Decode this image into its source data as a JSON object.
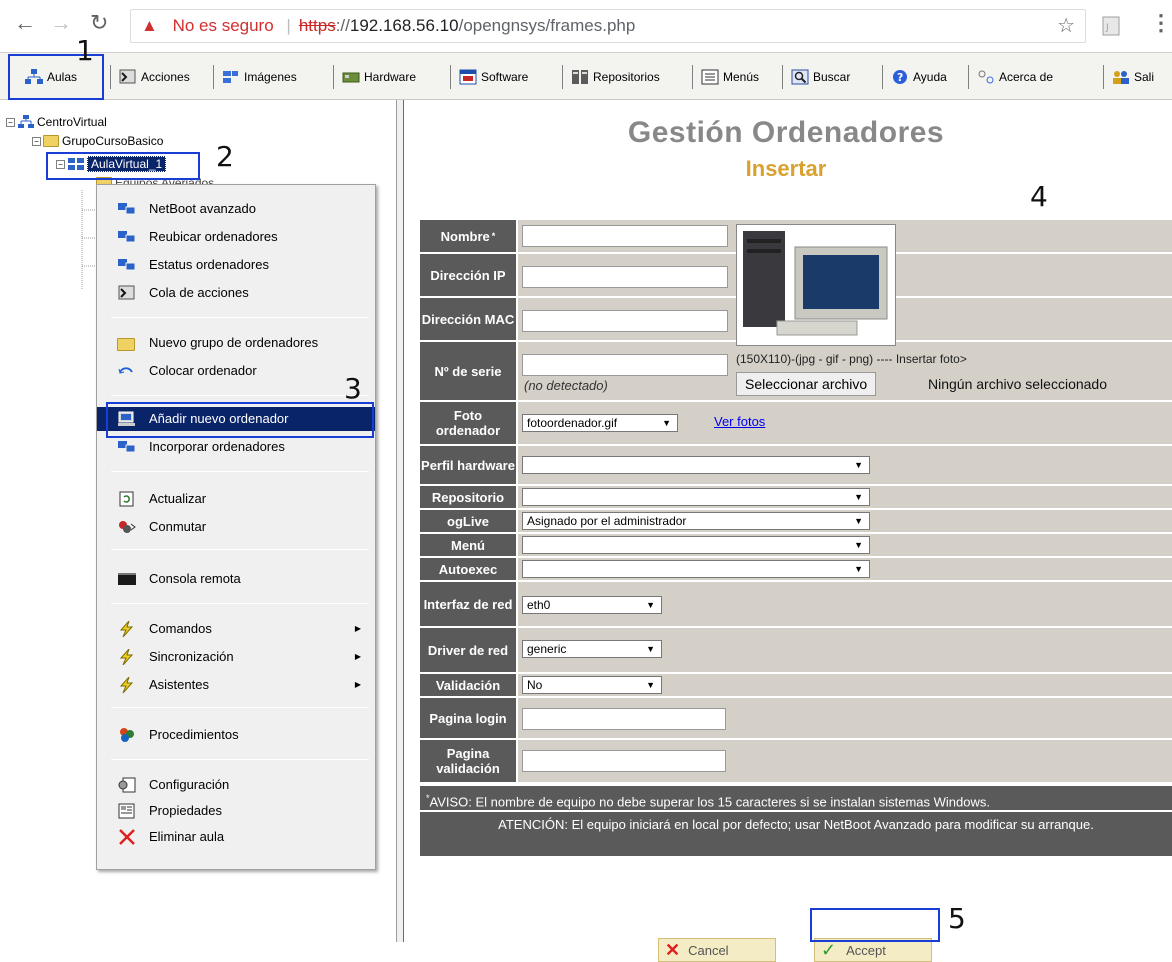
{
  "browser": {
    "security_label": "No es seguro",
    "url_scheme": "https",
    "url_sep": "://",
    "url_host": "192.168.56.10",
    "url_path": "/opengnsys/frames.php"
  },
  "toolbar": {
    "items": [
      {
        "label": "Aulas",
        "icon": "classroom-icon"
      },
      {
        "label": "Acciones",
        "icon": "actions-icon"
      },
      {
        "label": "Imágenes",
        "icon": "images-icon"
      },
      {
        "label": "Hardware",
        "icon": "hardware-icon"
      },
      {
        "label": "Software",
        "icon": "software-icon"
      },
      {
        "label": "Repositorios",
        "icon": "repositories-icon"
      },
      {
        "label": "Menús",
        "icon": "menus-icon"
      },
      {
        "label": "Buscar",
        "icon": "search-icon"
      },
      {
        "label": "Ayuda",
        "icon": "help-icon"
      },
      {
        "label": "Acerca de",
        "icon": "about-icon"
      },
      {
        "label": "Sali",
        "icon": "exit-icon"
      }
    ]
  },
  "tree": {
    "root": "CentroVirtual",
    "group": "GrupoCursoBasico",
    "classroom": "AulaVirtual_1",
    "hidden_child": "Equipos Averiados"
  },
  "context_menu": {
    "items": [
      "NetBoot avanzado",
      "Reubicar ordenadores",
      "Estatus ordenadores",
      "Cola de acciones",
      "Nuevo grupo de ordenadores",
      "Colocar ordenador",
      "Añadir nuevo ordenador",
      "Incorporar ordenadores",
      "Actualizar",
      "Conmutar",
      "Consola remota",
      "Comandos",
      "Sincronización",
      "Asistentes",
      "Procedimientos",
      "Configuración",
      "Propiedades",
      "Eliminar aula"
    ],
    "selected": "Añadir nuevo ordenador"
  },
  "page": {
    "title": "Gestión Ordenadores",
    "subtitle": "Insertar"
  },
  "form": {
    "labels": {
      "nombre": "Nombre",
      "nombre_mark": "*",
      "ip": "Dirección IP",
      "mac": "Dirección MAC",
      "serie": "Nº de serie",
      "foto": "Foto ordenador",
      "perfil": "Perfil hardware",
      "repositorio": "Repositorio",
      "oglive": "ogLive",
      "menu": "Menú",
      "autoexec": "Autoexec",
      "interfaz": "Interfaz de red",
      "driver": "Driver de red",
      "validacion": "Validación",
      "pagina_login": "Pagina login",
      "pagina_validacion": "Pagina validación"
    },
    "values": {
      "nombre": "",
      "ip": "",
      "mac": "",
      "serie": "",
      "serie_note": "(no detectado)",
      "foto": "fotoordenador.gif",
      "perfil": "",
      "repositorio": "",
      "oglive": "Asignado por el administrador",
      "menu": "",
      "autoexec": "",
      "interfaz": "eth0",
      "driver": "generic",
      "validacion": "No",
      "pagina_login": "",
      "pagina_validacion": ""
    },
    "photo_hint": "(150X110)-(jpg - gif - png) ---- Insertar foto>",
    "file_button": "Seleccionar archivo",
    "file_status": "Ningún archivo seleccionado",
    "ver_fotos": "Ver fotos",
    "notice_mark": "*",
    "notice": "AVISO: El nombre de equipo no debe superar los 15 caracteres si se instalan sistemas Windows.",
    "attention": "ATENCIÓN: El equipo iniciará en local por defecto; usar NetBoot Avanzado para modificar su arranque."
  },
  "buttons": {
    "cancel": "Cancel",
    "accept": "Accept"
  },
  "annotations": [
    "1",
    "2",
    "3",
    "4",
    "5"
  ],
  "colors": {
    "label_bg": "#5a5a5a",
    "value_bg": "#d4d0c8",
    "title": "#888888",
    "subtitle": "#d9a12f",
    "annotation": "#1a3dd6",
    "menu_selected": "#0a246a"
  }
}
